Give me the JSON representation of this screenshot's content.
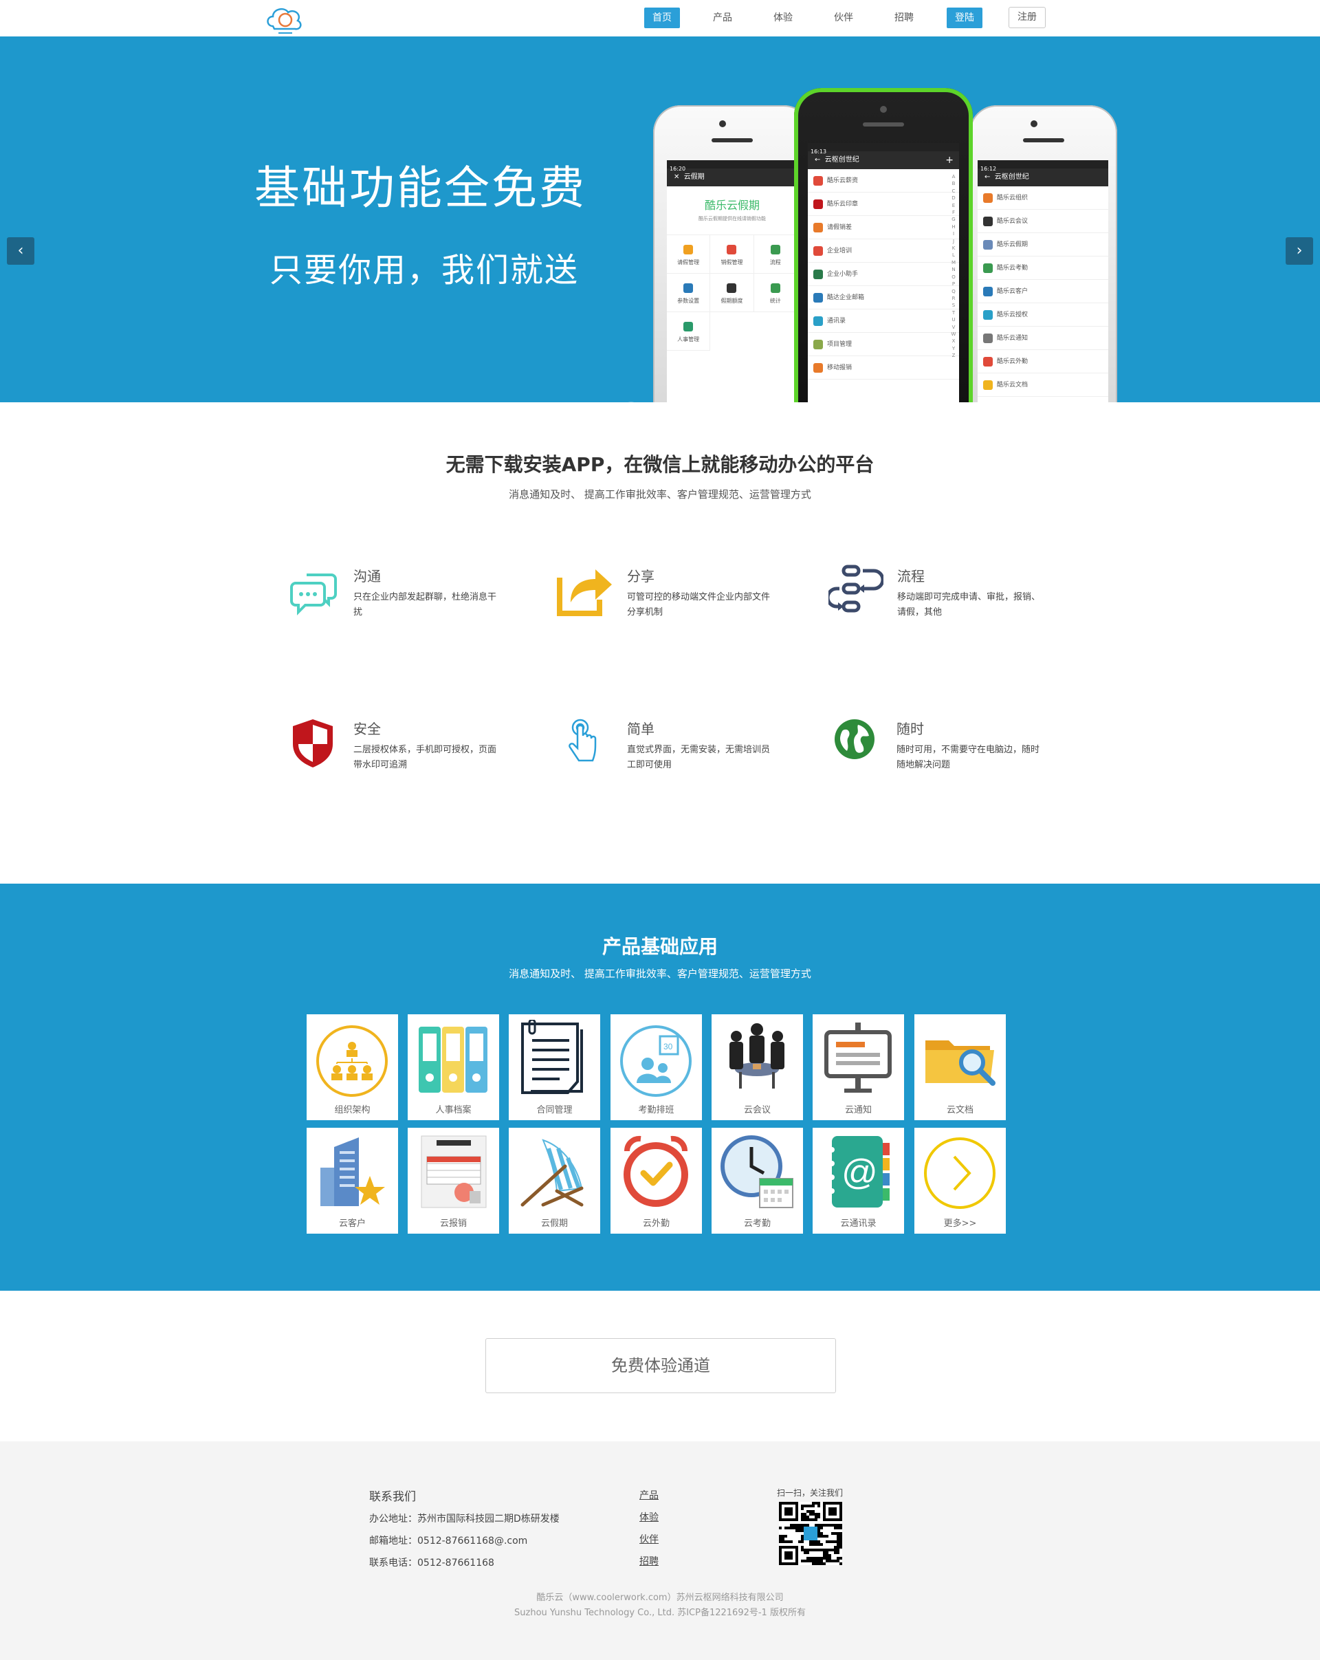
{
  "nav": {
    "items": [
      "首页",
      "产品",
      "体验",
      "伙伴",
      "招聘"
    ],
    "login": "登陆",
    "register": "注册",
    "logo_icon": "cloud-logo-icon"
  },
  "hero": {
    "title": "基础功能全免费",
    "subtitle": "只要你用，我们就送",
    "prev_icon": "chevron-left-icon",
    "next_icon": "chevron-right-icon",
    "slides": 2,
    "active_slide": 1,
    "left_phone": {
      "time": "16:20",
      "header": "云假期",
      "app_name": "酷乐云假期",
      "tagline": "酷乐云假期提供在线请销假功能",
      "cells": [
        "请假管理",
        "销假管理",
        "流程",
        "参数设置",
        "假期额度",
        "统计",
        "人事管理"
      ]
    },
    "center_phone": {
      "time": "16:13",
      "header": "云枢创世纪",
      "rows": [
        "酷乐云薪资",
        "酷乐云印章",
        "请假销差",
        "企业培训",
        "企业小助手",
        "酷达企业邮箱",
        "通讯录",
        "项目管理",
        "移动报销"
      ],
      "alphabet": [
        "A",
        "B",
        "C",
        "D",
        "E",
        "F",
        "G",
        "H",
        "I",
        "J",
        "K",
        "L",
        "M",
        "N",
        "O",
        "P",
        "Q",
        "R",
        "S",
        "T",
        "U",
        "V",
        "W",
        "X",
        "Y",
        "Z"
      ]
    },
    "right_phone": {
      "time": "16:12",
      "header": "云枢创世纪",
      "rows": [
        "酷乐云组织",
        "酷乐云会议",
        "酷乐云假期",
        "酷乐云考勤",
        "酷乐云客户",
        "酷乐云授权",
        "酷乐云通知",
        "酷乐云外勤",
        "酷乐云文档"
      ]
    }
  },
  "intro": {
    "title": "无需下载安装APP，在微信上就能移动办公的平台",
    "subtitle": "消息通知及时、 提高工作审批效率、客户管理规范、运营管理方式"
  },
  "features": [
    {
      "name": "沟通",
      "desc": "只在企业内部发起群聊，杜绝消息干扰",
      "icon": "chat-bubbles-icon",
      "color": "#4ed0c2"
    },
    {
      "name": "分享",
      "desc": "可管可控的移动端文件企业内部文件分享机制",
      "icon": "share-arrow-icon",
      "color": "#f0b41e"
    },
    {
      "name": "流程",
      "desc": "移动端即可完成申请、审批，报销、请假，其他",
      "icon": "workflow-icon",
      "color": "#3c4a6a"
    },
    {
      "name": "安全",
      "desc": "二层授权体系，手机即可授权，页面带水印可追溯",
      "icon": "shield-icon",
      "color": "#c0161c"
    },
    {
      "name": "简单",
      "desc": "直觉式界面，无需安装，无需培训员工即可使用",
      "icon": "touch-icon",
      "color": "#2a9fd8"
    },
    {
      "name": "随时",
      "desc": "随时可用，不需要守在电脑边，随时随地解决问题",
      "icon": "globe-icon",
      "color": "#2e8b3a"
    }
  ],
  "products": {
    "title": "产品基础应用",
    "subtitle": "消息通知及时、 提高工作审批效率、客户管理规范、运营管理方式",
    "tiles": [
      {
        "label": "组织架构",
        "icon": "org-chart-icon"
      },
      {
        "label": "人事档案",
        "icon": "binders-icon"
      },
      {
        "label": "合同管理",
        "icon": "contract-icon"
      },
      {
        "label": "考勤排班",
        "icon": "schedule-icon"
      },
      {
        "label": "云会议",
        "icon": "meeting-icon"
      },
      {
        "label": "云通知",
        "icon": "notice-board-icon"
      },
      {
        "label": "云文档",
        "icon": "folder-search-icon"
      },
      {
        "label": "云客户",
        "icon": "building-star-icon"
      },
      {
        "label": "云报销",
        "icon": "invoice-icon"
      },
      {
        "label": "云假期",
        "icon": "beach-chair-icon"
      },
      {
        "label": "云外勤",
        "icon": "alarm-clock-icon"
      },
      {
        "label": "云考勤",
        "icon": "clock-calendar-icon"
      },
      {
        "label": "云通讯录",
        "icon": "address-book-icon"
      },
      {
        "label": "更多>>",
        "icon": "more-arrow-icon"
      }
    ]
  },
  "cta": {
    "label": "免费体验通道"
  },
  "footer": {
    "contact_title": "联系我们",
    "address": "办公地址：苏州市国际科技园二期D栋研发楼",
    "email": "邮箱地址：0512-87661168@.com",
    "phone": "联系电话：0512-87661168",
    "links": [
      "产品",
      "体验",
      "伙伴",
      "招聘"
    ],
    "qr_label": "扫一扫，关注我们",
    "copyright_1": "酷乐云（www.coolerwork.com）苏州云枢网络科技有限公司",
    "copyright_2": "Suzhou Yunshu Technology Co., Ltd. 苏ICP备1221692号-1 版权所有"
  }
}
